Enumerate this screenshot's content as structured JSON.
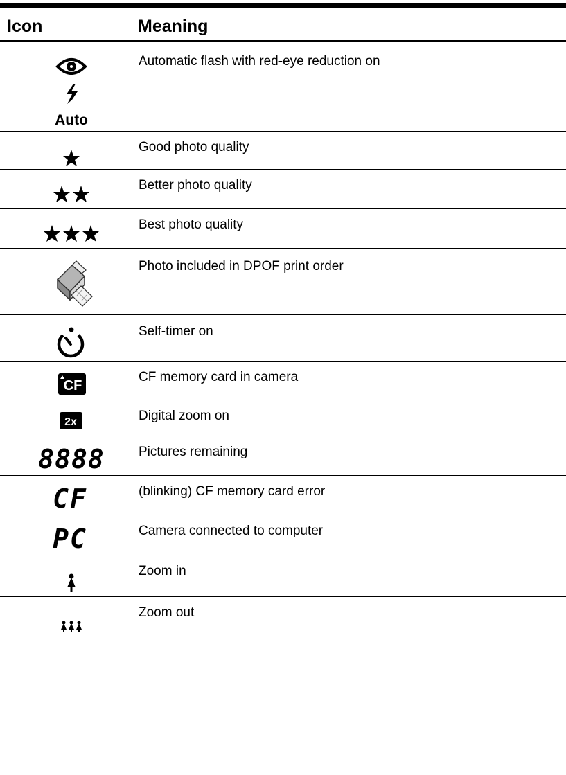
{
  "table": {
    "header_icon": "Icon",
    "header_meaning": "Meaning",
    "rows": [
      {
        "icon": "red-eye-auto-flash-icon",
        "icon_text": "Auto",
        "meaning": "Automatic flash with red-eye reduction on"
      },
      {
        "icon": "one-star-icon",
        "meaning": "Good photo quality"
      },
      {
        "icon": "two-stars-icon",
        "meaning": "Better photo quality"
      },
      {
        "icon": "three-stars-icon",
        "meaning": "Best photo quality"
      },
      {
        "icon": "printer-icon",
        "meaning": "Photo included in DPOF print order"
      },
      {
        "icon": "self-timer-icon",
        "meaning": "Self-timer on"
      },
      {
        "icon": "cf-card-icon",
        "icon_text": "CF",
        "meaning": "CF memory card in camera"
      },
      {
        "icon": "digital-zoom-icon",
        "icon_text": "2x",
        "meaning": "Digital zoom on"
      },
      {
        "icon": "segment-8888-icon",
        "icon_text": "8888",
        "meaning": "Pictures remaining"
      },
      {
        "icon": "segment-cf-icon",
        "icon_text": "CF",
        "meaning": "(blinking) CF memory card error"
      },
      {
        "icon": "segment-pc-icon",
        "icon_text": "PC",
        "meaning": "Camera connected to computer"
      },
      {
        "icon": "zoom-in-icon",
        "meaning": "Zoom in"
      },
      {
        "icon": "zoom-out-icon",
        "meaning": "Zoom out"
      }
    ]
  }
}
